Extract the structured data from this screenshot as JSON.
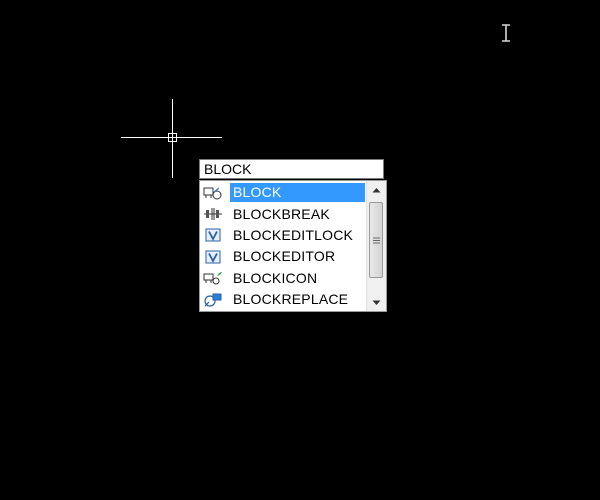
{
  "command_line": {
    "value": "BLOCK"
  },
  "autocomplete": {
    "items": [
      {
        "label": "BLOCK",
        "icon": "block-create-icon",
        "selected": true
      },
      {
        "label": "BLOCKBREAK",
        "icon": "block-break-icon",
        "selected": false
      },
      {
        "label": "BLOCKEDITLOCK",
        "icon": "block-edit-lock-icon",
        "selected": false
      },
      {
        "label": "BLOCKEDITOR",
        "icon": "block-editor-icon",
        "selected": false
      },
      {
        "label": "BLOCKICON",
        "icon": "block-icon-icon",
        "selected": false
      },
      {
        "label": "BLOCKREPLACE",
        "icon": "block-replace-icon",
        "selected": false
      }
    ]
  },
  "colors": {
    "canvas_background": "#000000",
    "selection": "#3399ff",
    "crosshair": "#ffffff"
  }
}
